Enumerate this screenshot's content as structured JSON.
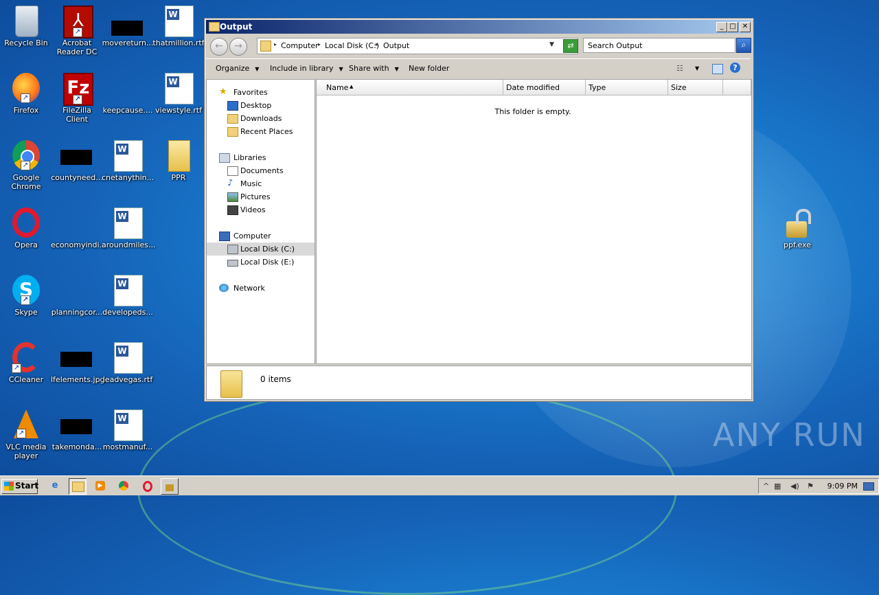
{
  "desktop": {
    "icons": [
      {
        "label": "Recycle Bin"
      },
      {
        "label": "Acrobat Reader DC"
      },
      {
        "label": "movereturn..."
      },
      {
        "label": "thatmillion.rtf"
      },
      {
        "label": "Firefox"
      },
      {
        "label": "FileZilla Client"
      },
      {
        "label": "keepcause...."
      },
      {
        "label": "viewstyle.rtf"
      },
      {
        "label": "Google Chrome"
      },
      {
        "label": "countyneed..."
      },
      {
        "label": "cnetanythin..."
      },
      {
        "label": "PPR"
      },
      {
        "label": "Opera"
      },
      {
        "label": "economyindi..."
      },
      {
        "label": "aroundmiles..."
      },
      {
        "label": "Skype"
      },
      {
        "label": "planningcor..."
      },
      {
        "label": "developeds..."
      },
      {
        "label": "CCleaner"
      },
      {
        "label": "lfelements.jpg"
      },
      {
        "label": "leadvegas.rtf"
      },
      {
        "label": "VLC media player"
      },
      {
        "label": "takemonda..."
      },
      {
        "label": "mostmanuf..."
      },
      {
        "label": "ppf.exe"
      }
    ]
  },
  "window": {
    "title": "Output",
    "address": {
      "segments": [
        "Computer",
        "Local Disk (C:)",
        "Output"
      ]
    },
    "search_placeholder": "Search Output",
    "toolbar": {
      "organize": "Organize",
      "include_in_library": "Include in library",
      "share_with": "Share with",
      "new_folder": "New folder"
    },
    "nav": {
      "favorites": "Favorites",
      "desktop": "Desktop",
      "downloads": "Downloads",
      "recent_places": "Recent Places",
      "libraries": "Libraries",
      "documents": "Documents",
      "music": "Music",
      "pictures": "Pictures",
      "videos": "Videos",
      "computer": "Computer",
      "local_disk_c": "Local Disk (C:)",
      "local_disk_e": "Local Disk (E:)",
      "network": "Network"
    },
    "columns": [
      "Name",
      "Date modified",
      "Type",
      "Size"
    ],
    "empty_message": "This folder is empty.",
    "status": "0 items"
  },
  "taskbar": {
    "start": "Start",
    "clock": "9:09 PM"
  },
  "watermark": "ANY RUN"
}
